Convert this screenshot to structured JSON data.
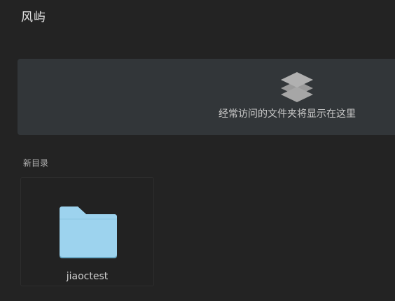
{
  "app": {
    "title": "风屿"
  },
  "frequent": {
    "empty_message": "经常访问的文件夹将显示在这里",
    "icon": "layers-icon"
  },
  "directory": {
    "label": "新目录",
    "folders": [
      {
        "name": "jiaoctest",
        "icon": "folder-icon",
        "color": "#9dd3ee"
      }
    ]
  },
  "colors": {
    "background": "#232323",
    "panel": "#323639",
    "folder": "#9dd3ee",
    "folder_shadow": "#6aa9c6",
    "icon_gray": "#a6a6a6"
  }
}
